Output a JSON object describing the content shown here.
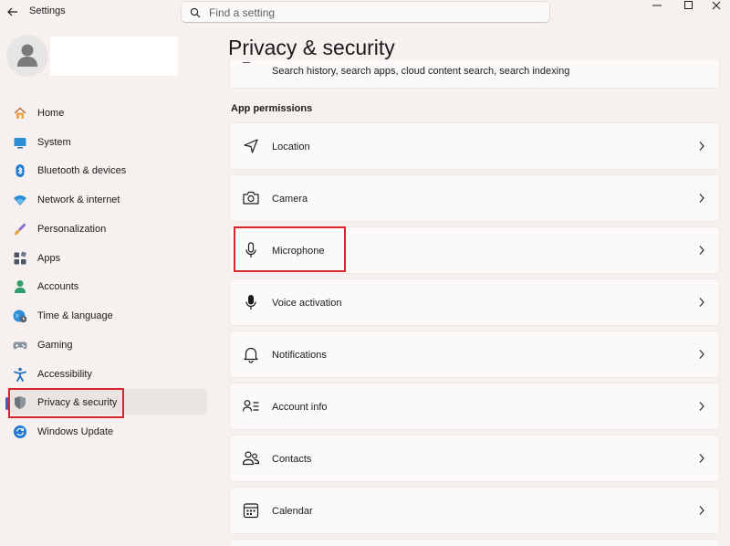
{
  "window": {
    "app_title": "Settings",
    "search_placeholder": "Find a setting"
  },
  "sidebar": {
    "items": [
      {
        "label": "Home",
        "icon": "home-icon"
      },
      {
        "label": "System",
        "icon": "system-icon"
      },
      {
        "label": "Bluetooth & devices",
        "icon": "bluetooth-icon"
      },
      {
        "label": "Network & internet",
        "icon": "wifi-icon"
      },
      {
        "label": "Personalization",
        "icon": "brush-icon"
      },
      {
        "label": "Apps",
        "icon": "apps-icon"
      },
      {
        "label": "Accounts",
        "icon": "person-icon"
      },
      {
        "label": "Time & language",
        "icon": "globe-clock-icon"
      },
      {
        "label": "Gaming",
        "icon": "gamepad-icon"
      },
      {
        "label": "Accessibility",
        "icon": "accessibility-icon"
      },
      {
        "label": "Privacy & security",
        "icon": "shield-icon",
        "selected": true
      },
      {
        "label": "Windows Update",
        "icon": "update-icon"
      }
    ]
  },
  "main": {
    "title": "Privacy & security",
    "partial_card_description": "Search history, search apps, cloud content search, search indexing",
    "section_label": "App permissions",
    "permissions": [
      {
        "label": "Location",
        "icon": "location-icon"
      },
      {
        "label": "Camera",
        "icon": "camera-icon"
      },
      {
        "label": "Microphone",
        "icon": "microphone-icon"
      },
      {
        "label": "Voice activation",
        "icon": "voice-activation-icon"
      },
      {
        "label": "Notifications",
        "icon": "bell-icon"
      },
      {
        "label": "Account info",
        "icon": "account-info-icon"
      },
      {
        "label": "Contacts",
        "icon": "contacts-icon"
      },
      {
        "label": "Calendar",
        "icon": "calendar-icon"
      }
    ]
  },
  "colors": {
    "highlight": "#d6262b",
    "accent": "#3c60b4",
    "background": "#f6f1ef",
    "card": "#fbfaf9"
  }
}
